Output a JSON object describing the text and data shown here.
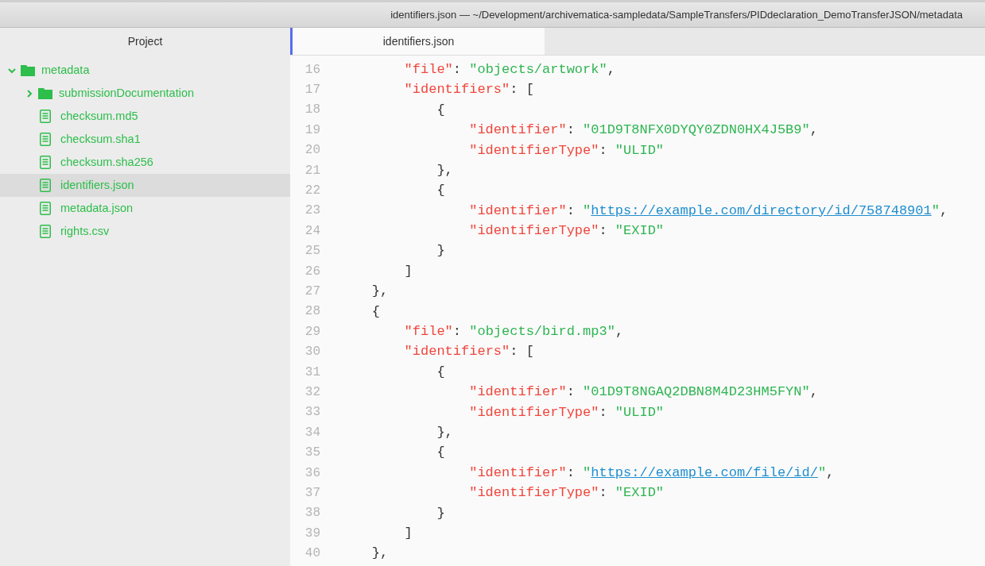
{
  "window": {
    "title": "identifiers.json — ~/Development/archivematica-sampledata/SampleTransfers/PIDdeclaration_DemoTransferJSON/metadata"
  },
  "sidebar": {
    "title": "Project",
    "tree": [
      {
        "kind": "folder",
        "label": "metadata",
        "expanded": true,
        "selected": false,
        "children": [
          {
            "kind": "folder",
            "label": "submissionDocumentation",
            "expanded": false,
            "selected": false
          },
          {
            "kind": "file",
            "label": "checksum.md5",
            "selected": false
          },
          {
            "kind": "file",
            "label": "checksum.sha1",
            "selected": false
          },
          {
            "kind": "file",
            "label": "checksum.sha256",
            "selected": false
          },
          {
            "kind": "file",
            "label": "identifiers.json",
            "selected": true
          },
          {
            "kind": "file",
            "label": "metadata.json",
            "selected": false
          },
          {
            "kind": "file",
            "label": "rights.csv",
            "selected": false
          }
        ]
      }
    ]
  },
  "tabs": [
    {
      "label": "identifiers.json",
      "selected": true
    }
  ],
  "editor": {
    "lines": [
      {
        "number": "16",
        "tokens": [
          {
            "kind": "key",
            "text": "\"file\""
          },
          {
            "kind": "punct",
            "text": ": "
          },
          {
            "kind": "string",
            "text": "\"objects/artwork\""
          },
          {
            "kind": "punct",
            "text": ","
          }
        ]
      },
      {
        "number": "17",
        "tokens": [
          {
            "kind": "key",
            "text": "\"identifiers\""
          },
          {
            "kind": "punct",
            "text": ": ["
          }
        ]
      },
      {
        "number": "18",
        "tokens": [
          {
            "kind": "punct",
            "text": "{"
          }
        ]
      },
      {
        "number": "19",
        "tokens": [
          {
            "kind": "key",
            "text": "\"identifier\""
          },
          {
            "kind": "punct",
            "text": ": "
          },
          {
            "kind": "string",
            "text": "\"01D9T8NFX0DYQY0ZDN0HX4J5B9\""
          },
          {
            "kind": "punct",
            "text": ","
          }
        ]
      },
      {
        "number": "20",
        "tokens": [
          {
            "kind": "key",
            "text": "\"identifierType\""
          },
          {
            "kind": "punct",
            "text": ": "
          },
          {
            "kind": "string",
            "text": "\"ULID\""
          }
        ]
      },
      {
        "number": "21",
        "tokens": [
          {
            "kind": "punct",
            "text": "},"
          }
        ]
      },
      {
        "number": "22",
        "tokens": [
          {
            "kind": "punct",
            "text": "{"
          }
        ]
      },
      {
        "number": "23",
        "tokens": [
          {
            "kind": "key",
            "text": "\"identifier\""
          },
          {
            "kind": "punct",
            "text": ": "
          },
          {
            "kind": "string",
            "text": "\""
          },
          {
            "kind": "link",
            "text": "https://example.com/directory/id/758748901"
          },
          {
            "kind": "string",
            "text": "\""
          },
          {
            "kind": "punct",
            "text": ","
          }
        ]
      },
      {
        "number": "24",
        "tokens": [
          {
            "kind": "key",
            "text": "\"identifierType\""
          },
          {
            "kind": "punct",
            "text": ": "
          },
          {
            "kind": "string",
            "text": "\"EXID\""
          }
        ]
      },
      {
        "number": "25",
        "tokens": [
          {
            "kind": "punct",
            "text": "}"
          }
        ]
      },
      {
        "number": "26",
        "tokens": [
          {
            "kind": "punct",
            "text": "]"
          }
        ]
      },
      {
        "number": "27",
        "tokens": [
          {
            "kind": "punct",
            "text": "},"
          }
        ]
      },
      {
        "number": "28",
        "tokens": [
          {
            "kind": "punct",
            "text": "{"
          }
        ]
      },
      {
        "number": "29",
        "tokens": [
          {
            "kind": "key",
            "text": "\"file\""
          },
          {
            "kind": "punct",
            "text": ": "
          },
          {
            "kind": "string",
            "text": "\"objects/bird.mp3\""
          },
          {
            "kind": "punct",
            "text": ","
          }
        ]
      },
      {
        "number": "30",
        "tokens": [
          {
            "kind": "key",
            "text": "\"identifiers\""
          },
          {
            "kind": "punct",
            "text": ": ["
          }
        ]
      },
      {
        "number": "31",
        "tokens": [
          {
            "kind": "punct",
            "text": "{"
          }
        ]
      },
      {
        "number": "32",
        "tokens": [
          {
            "kind": "key",
            "text": "\"identifier\""
          },
          {
            "kind": "punct",
            "text": ": "
          },
          {
            "kind": "string",
            "text": "\"01D9T8NGAQ2DBN8M4D23HM5FYN\""
          },
          {
            "kind": "punct",
            "text": ","
          }
        ]
      },
      {
        "number": "33",
        "tokens": [
          {
            "kind": "key",
            "text": "\"identifierType\""
          },
          {
            "kind": "punct",
            "text": ": "
          },
          {
            "kind": "string",
            "text": "\"ULID\""
          }
        ]
      },
      {
        "number": "34",
        "tokens": [
          {
            "kind": "punct",
            "text": "},"
          }
        ]
      },
      {
        "number": "35",
        "tokens": [
          {
            "kind": "punct",
            "text": "{"
          }
        ]
      },
      {
        "number": "36",
        "tokens": [
          {
            "kind": "key",
            "text": "\"identifier\""
          },
          {
            "kind": "punct",
            "text": ": "
          },
          {
            "kind": "string",
            "text": "\""
          },
          {
            "kind": "link",
            "text": "https://example.com/file/id/"
          },
          {
            "kind": "string",
            "text": "\""
          },
          {
            "kind": "punct",
            "text": ","
          }
        ]
      },
      {
        "number": "37",
        "tokens": [
          {
            "kind": "key",
            "text": "\"identifierType\""
          },
          {
            "kind": "punct",
            "text": ": "
          },
          {
            "kind": "string",
            "text": "\"EXID\""
          }
        ]
      },
      {
        "number": "38",
        "tokens": [
          {
            "kind": "punct",
            "text": "}"
          }
        ]
      },
      {
        "number": "39",
        "tokens": [
          {
            "kind": "punct",
            "text": "]"
          }
        ]
      },
      {
        "number": "40",
        "tokens": [
          {
            "kind": "punct",
            "text": "},"
          }
        ]
      }
    ]
  }
}
